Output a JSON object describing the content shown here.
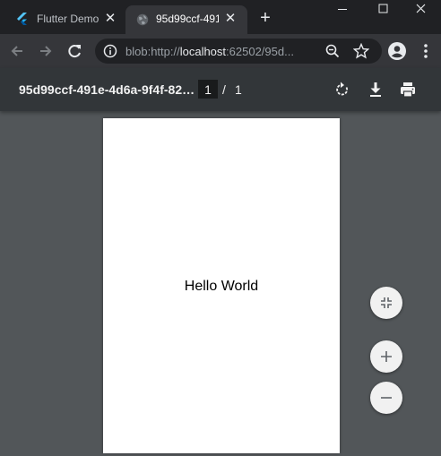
{
  "tabs": [
    {
      "title": "Flutter Demo",
      "icon": "flutter-logo-icon"
    },
    {
      "title": "95d99ccf-491",
      "icon": "globe-icon",
      "active": true
    }
  ],
  "window_controls": {
    "minimize": "minimize-icon",
    "maximize": "maximize-icon",
    "close": "close-icon"
  },
  "address_bar": {
    "prefix": "blob:http://",
    "host": "localhost",
    "rest": ":62502/95d..."
  },
  "pdf_viewer": {
    "title": "95d99ccf-491e-4d6a-9f4f-82d...",
    "current_page": "1",
    "separator": "/",
    "total_pages": "1"
  },
  "document": {
    "text": "Hello World"
  },
  "colors": {
    "tabstrip": "#202124",
    "toolbar": "#35363a",
    "pdf_bar": "#323639",
    "viewer_bg": "#525659"
  }
}
